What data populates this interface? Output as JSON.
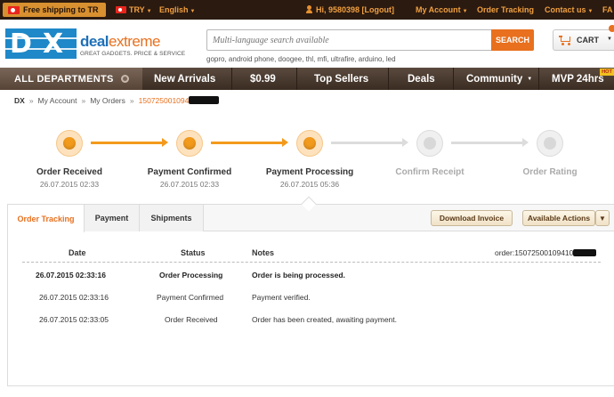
{
  "topbar": {
    "shipping": "Free shipping to TR",
    "currency": "TRY",
    "language": "English",
    "greeting": "Hi, 9580398 [Logout]",
    "my_account": "My Account",
    "order_tracking": "Order Tracking",
    "contact_us": "Contact us",
    "faq": "FA"
  },
  "header": {
    "logo_letters": {
      "d": "D",
      "x": "X"
    },
    "logo_deal": "deal",
    "logo_extreme": "extreme",
    "logo_tagline": "GREAT GADGETS. PRICE & SERVICE",
    "search_placeholder": "Multi-language search available",
    "search_button": "SEARCH",
    "keywords": "gopro, android phone, doogee, thl, mfi, ultrafire, arduino, led",
    "cart_label": "CART"
  },
  "nav": {
    "all_departments": "ALL DEPARTMENTS",
    "items": [
      "New Arrivals",
      "$0.99",
      "Top Sellers",
      "Deals",
      "Community",
      "MVP 24hrs"
    ],
    "hot_badge": "HOT"
  },
  "breadcrumb": {
    "home": "DX",
    "my_account": "My Account",
    "my_orders": "My Orders",
    "current": "150725001094"
  },
  "progress": {
    "steps": [
      {
        "label": "Order Received",
        "date": "26.07.2015 02:33",
        "state": "done"
      },
      {
        "label": "Payment Confirmed",
        "date": "26.07.2015 02:33",
        "state": "done"
      },
      {
        "label": "Payment Processing",
        "date": "26.07.2015 05:36",
        "state": "current"
      },
      {
        "label": "Confirm Receipt",
        "date": "",
        "state": "pending"
      },
      {
        "label": "Order Rating",
        "date": "",
        "state": "pending"
      }
    ]
  },
  "panel": {
    "tabs": [
      "Order Tracking",
      "Payment",
      "Shipments"
    ],
    "download_invoice": "Download Invoice",
    "available_actions": "Available Actions",
    "columns": {
      "date": "Date",
      "status": "Status",
      "notes": "Notes"
    },
    "order_ref": "order:15072500109410",
    "rows": [
      {
        "date": "26.07.2015 02:33:16",
        "status": "Order Processing",
        "notes": "Order is being processed."
      },
      {
        "date": "26.07.2015 02:33:16",
        "status": "Payment Confirmed",
        "notes": "Payment verified."
      },
      {
        "date": "26.07.2015 02:33:05",
        "status": "Order Received",
        "notes": "Order has been created, awaiting payment."
      }
    ]
  },
  "colors": {
    "accent_orange": "#e8701e",
    "logo_blue": "#1e88c8",
    "topbar_bg": "#2b1a10",
    "nav_bg": "#4a3a2e",
    "step_done": "#f29a1c",
    "step_pending": "#d8d8d8"
  },
  "icons": {
    "flag": "turkey-flag-icon",
    "user": "user-icon",
    "cart": "cart-icon",
    "caret": "chevron-down-icon"
  }
}
